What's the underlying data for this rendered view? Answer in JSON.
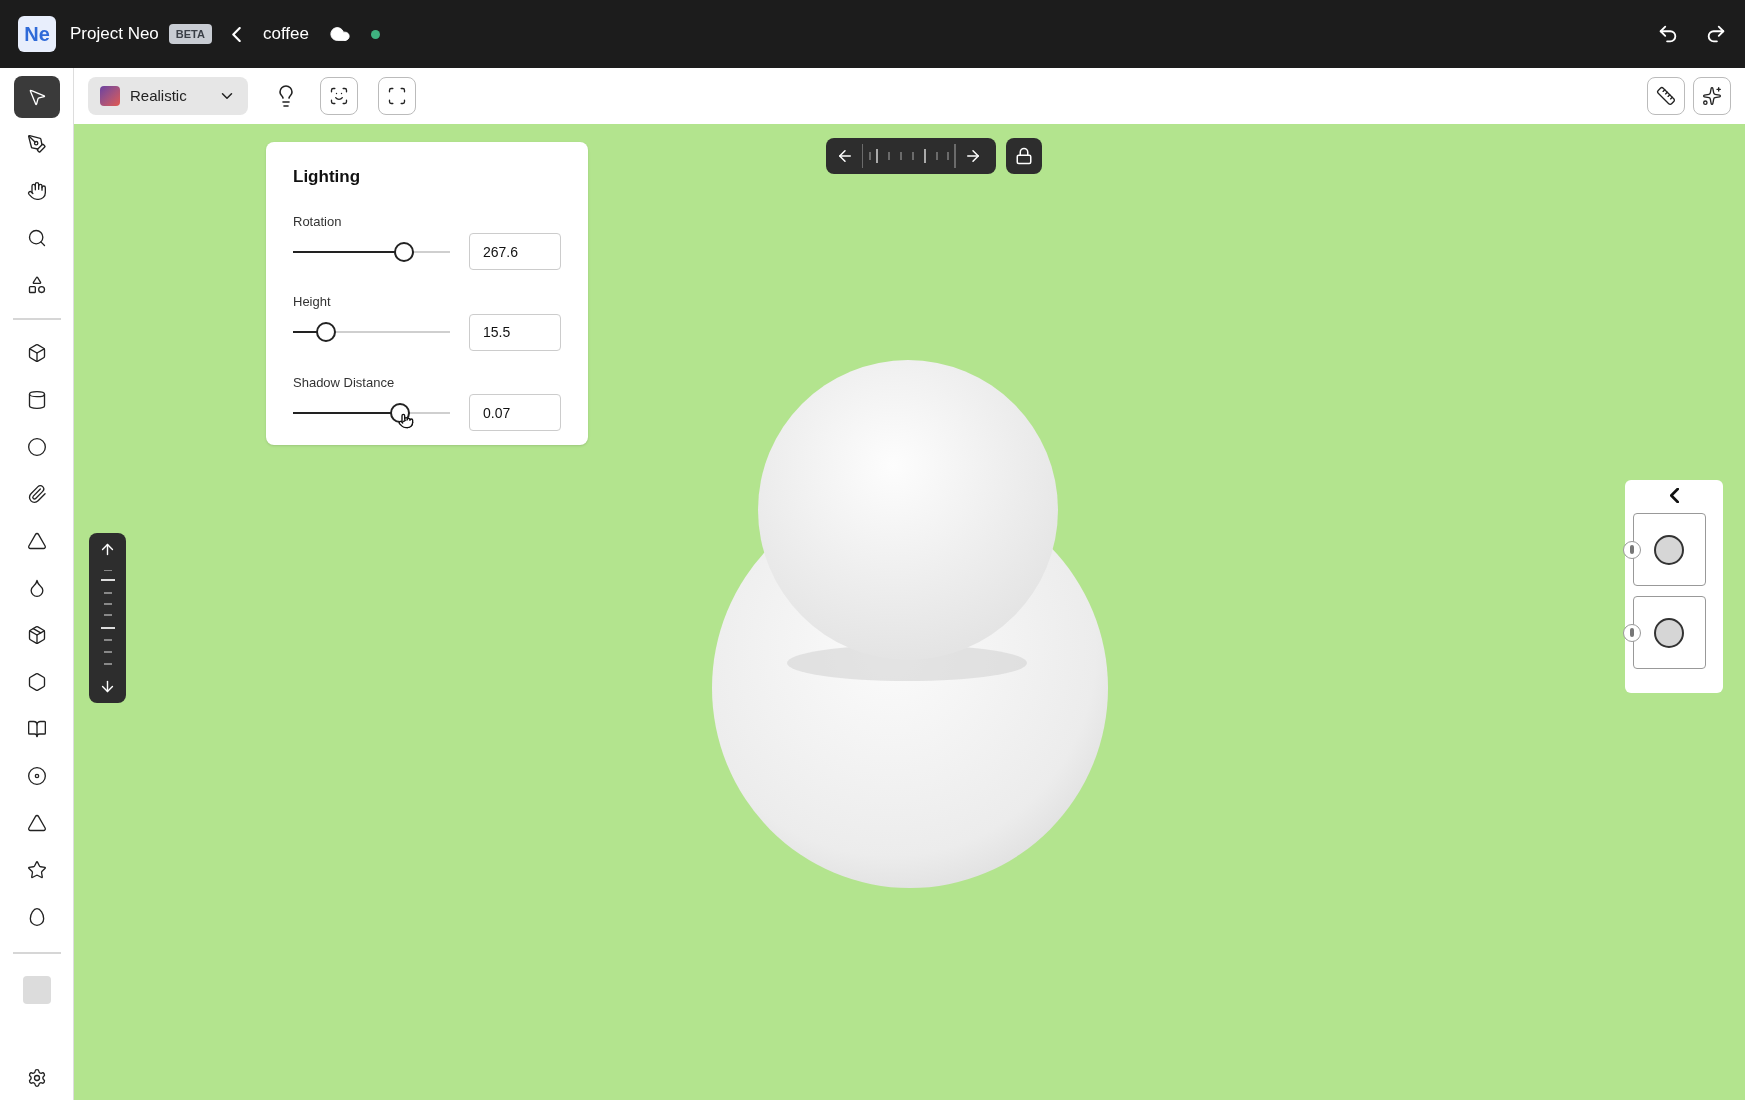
{
  "header": {
    "app_logo": "Ne",
    "app_name": "Project Neo",
    "badge": "BETA",
    "document": "coffee"
  },
  "sidebar": {
    "tools": [
      {
        "selected": true
      },
      {
        "selected": false
      },
      {
        "selected": false
      },
      {
        "selected": false
      },
      {
        "selected": false
      },
      {
        "selected": false
      },
      {
        "selected": false
      },
      {
        "selected": false
      },
      {
        "selected": false
      },
      {
        "selected": false
      },
      {
        "selected": false
      },
      {
        "selected": false
      },
      {
        "selected": false
      },
      {
        "selected": false
      },
      {
        "selected": false
      },
      {
        "selected": false
      },
      {
        "selected": false
      },
      {
        "selected": false
      }
    ]
  },
  "toolbar": {
    "render_mode": "Realistic"
  },
  "lighting_panel": {
    "title": "Lighting",
    "controls": [
      {
        "label": "Rotation",
        "level": 0.71,
        "value": "267.6"
      },
      {
        "label": "Height",
        "level": 0.21,
        "value": "15.5"
      },
      {
        "label": "Shadow Distance",
        "level": 0.68,
        "value": "0.07"
      }
    ]
  }
}
